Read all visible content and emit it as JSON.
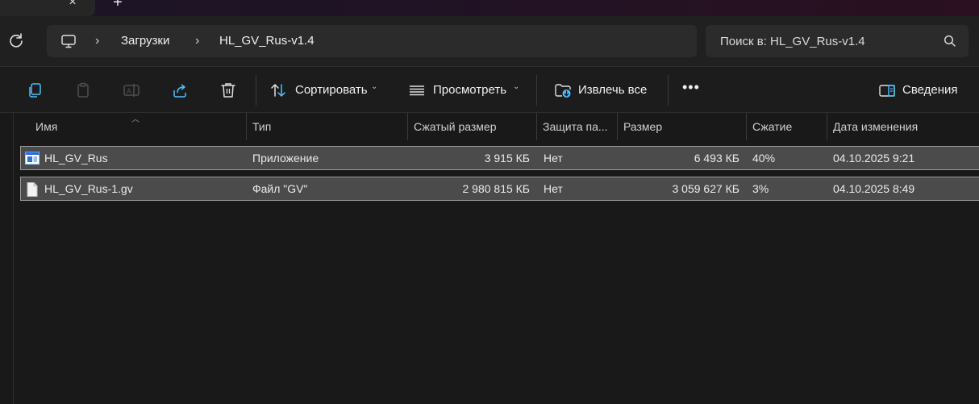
{
  "titlebar": {
    "close_tab_glyph": "×",
    "new_tab_glyph": "+"
  },
  "address": {
    "breadcrumb": [
      "Загрузки",
      "HL_GV_Rus-v1.4"
    ],
    "separator": "›"
  },
  "search": {
    "placeholder": "Поиск в: HL_GV_Rus-v1.4"
  },
  "toolbar": {
    "icons": [
      "copy-icon",
      "paste-icon",
      "rename-icon",
      "share-icon",
      "delete-icon"
    ],
    "sort_label": "Сортировать",
    "view_label": "Просмотреть",
    "extract_label": "Извлечь все",
    "more_glyph": "•••",
    "details_label": "Сведения",
    "chevron": "⌄"
  },
  "columns": {
    "name": "Имя",
    "type": "Тип",
    "compressed_size": "Сжатый размер",
    "protection": "Защита па...",
    "size": "Размер",
    "ratio": "Сжатие",
    "modified": "Дата изменения"
  },
  "files": [
    {
      "icon": "application-icon",
      "name": "HL_GV_Rus",
      "type": "Приложение",
      "compressed_size": "3 915 КБ",
      "protection": "Нет",
      "size": "6 493 КБ",
      "ratio": "40%",
      "modified": "04.10.2025 9:21"
    },
    {
      "icon": "file-icon",
      "name": "HL_GV_Rus-1.gv",
      "type": "Файл \"GV\"",
      "compressed_size": "2 980 815 КБ",
      "protection": "Нет",
      "size": "3 059 627 КБ",
      "ratio": "3%",
      "modified": "04.10.2025 8:49"
    }
  ],
  "colors": {
    "background": "#191919",
    "accent": "#4cc2ff",
    "selection": "#4b4b4b"
  }
}
